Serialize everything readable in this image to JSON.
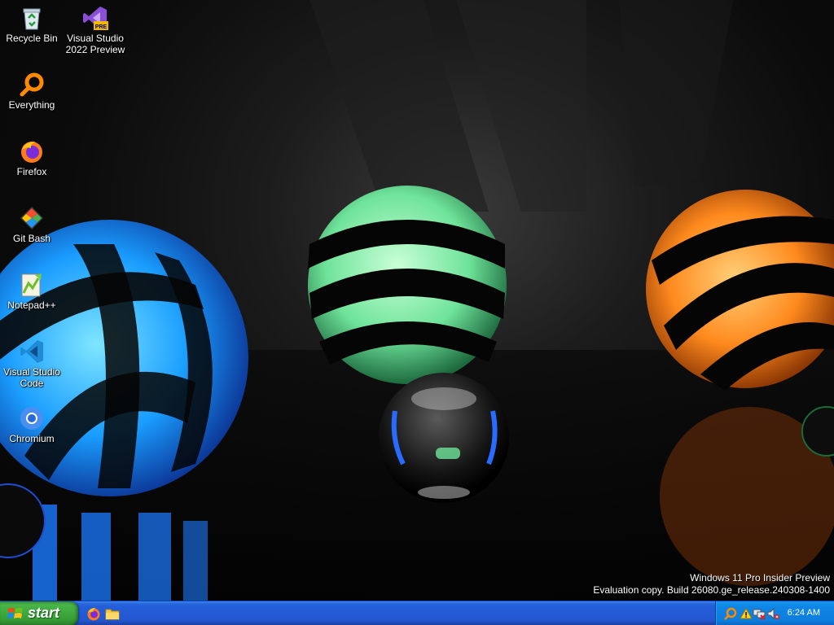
{
  "desktop": {
    "icons": [
      {
        "label": "Recycle Bin",
        "icon": "recycle-bin-icon"
      },
      {
        "label": "Visual Studio 2022 Preview",
        "label_line1": "Visual Studio",
        "label_line2": "2022 Preview",
        "icon": "visual-studio-icon",
        "badge": "PRE"
      },
      {
        "label": "Everything",
        "icon": "everything-search-icon"
      },
      {
        "label": "Firefox",
        "icon": "firefox-icon"
      },
      {
        "label": "Git Bash",
        "icon": "git-bash-icon"
      },
      {
        "label": "Notepad++",
        "icon": "notepadpp-icon"
      },
      {
        "label": "Visual Studio Code",
        "label_line1": "Visual Studio",
        "label_line2": "Code",
        "icon": "vscode-icon"
      },
      {
        "label": "Chromium",
        "icon": "chromium-icon"
      }
    ]
  },
  "watermark": {
    "line1": "Windows 11 Pro Insider Preview",
    "line2": "Evaluation copy. Build 26080.ge_release.240308-1400"
  },
  "taskbar": {
    "start_label": "start",
    "quick_launch": [
      {
        "name": "firefox-icon"
      },
      {
        "name": "folder-icon"
      }
    ],
    "tray": {
      "icons": [
        "search-icon",
        "warning-icon",
        "network-disconnected-icon",
        "volume-muted-icon"
      ],
      "clock": "6:24 AM"
    }
  },
  "colors": {
    "taskbar_blue": "#245edb",
    "start_green": "#3c9b3c",
    "tray_blue": "#0f86e6"
  }
}
